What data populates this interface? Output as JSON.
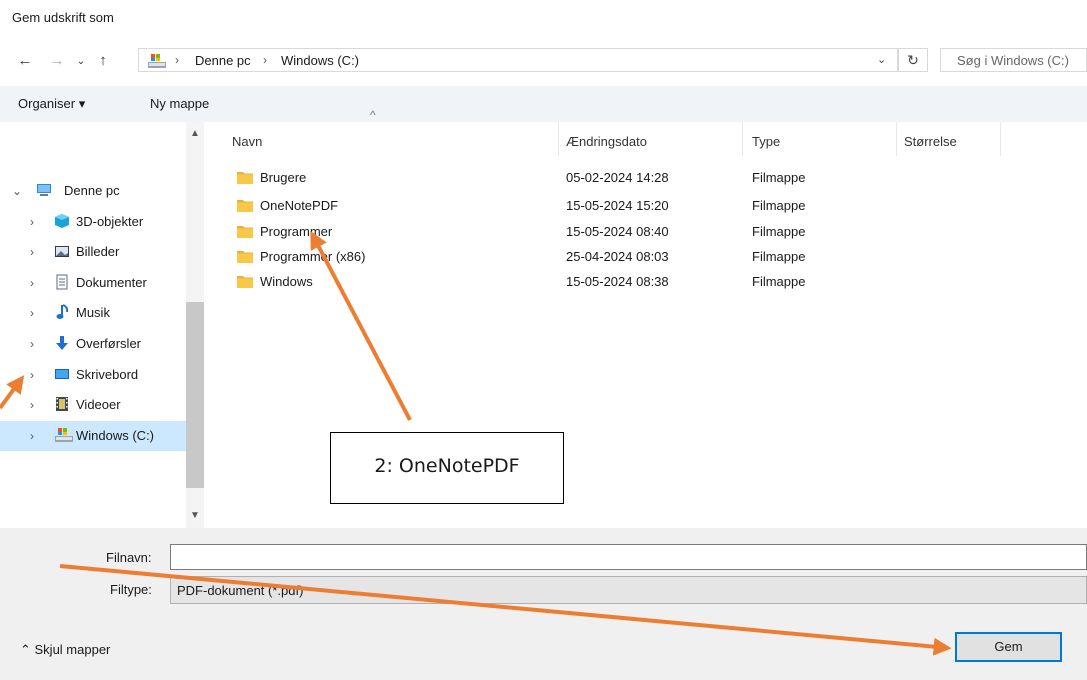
{
  "window": {
    "title": "Gem udskrift som"
  },
  "nav": {
    "back": "←",
    "forward": "→",
    "recent": "⌄",
    "up": "↑"
  },
  "address": {
    "crumbs": [
      "Denne pc",
      "Windows (C:)"
    ],
    "separator": "›",
    "dropdown": "⌄",
    "refresh": "↻"
  },
  "search": {
    "placeholder": "Søg i Windows (C:)"
  },
  "toolbar": {
    "organise": "Organiser ▾",
    "new_folder": "Ny mappe"
  },
  "sidebar": {
    "root": {
      "label": "Denne pc",
      "chevron": "⌄"
    },
    "items": [
      {
        "label": "3D-objekter",
        "icon": "cube-icon"
      },
      {
        "label": "Billeder",
        "icon": "pictures-icon"
      },
      {
        "label": "Dokumenter",
        "icon": "documents-icon"
      },
      {
        "label": "Musik",
        "icon": "music-icon"
      },
      {
        "label": "Overførsler",
        "icon": "downloads-icon"
      },
      {
        "label": "Skrivebord",
        "icon": "desktop-icon"
      },
      {
        "label": "Videoer",
        "icon": "videos-icon"
      },
      {
        "label": "Windows (C:)",
        "icon": "drive-icon",
        "selected": true
      }
    ],
    "chevron": "›"
  },
  "columns": {
    "name": "Navn",
    "date": "Ændringsdato",
    "type": "Type",
    "size": "Størrelse"
  },
  "files": [
    {
      "name": "Brugere",
      "date": "05-02-2024 14:28",
      "type": "Filmappe"
    },
    {
      "name": "OneNotePDF",
      "date": "15-05-2024 15:20",
      "type": "Filmappe"
    },
    {
      "name": "Programmer",
      "date": "15-05-2024 08:40",
      "type": "Filmappe"
    },
    {
      "name": "Programmer (x86)",
      "date": "25-04-2024 08:03",
      "type": "Filmappe"
    },
    {
      "name": "Windows",
      "date": "15-05-2024 08:38",
      "type": "Filmappe"
    }
  ],
  "bottom": {
    "filename_label": "Filnavn:",
    "filename_value": "",
    "filetype_label": "Filtype:",
    "filetype_value": "PDF-dokument (*.pdf)",
    "toggle_folders": "⌃  Skjul mapper",
    "save_button": "Gem"
  },
  "annotation": {
    "callout": "2: OneNotePDF",
    "arrow_color": "#ed7d31"
  },
  "colors": {
    "selection": "#cce8ff",
    "folder": "#f8c948",
    "accent": "#0078d7"
  }
}
